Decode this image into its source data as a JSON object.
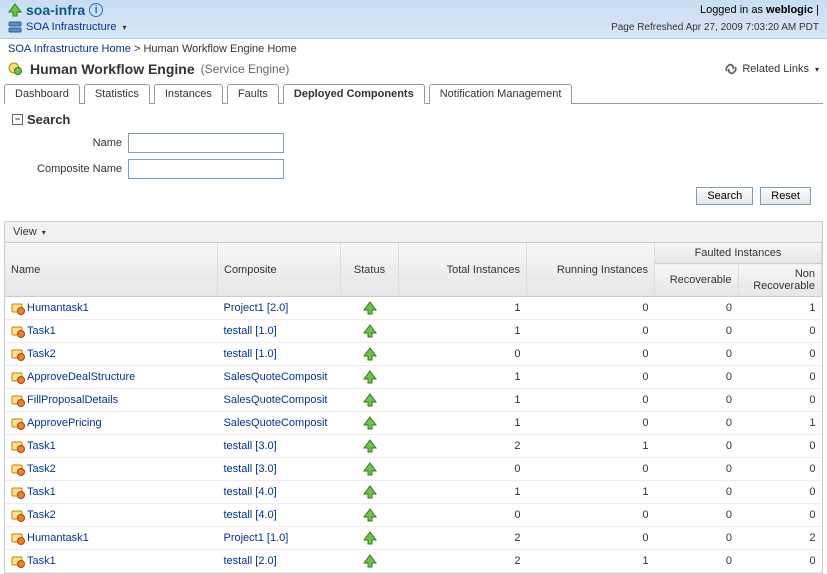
{
  "banner": {
    "title": "soa-infra",
    "infra_label": "SOA Infrastructure",
    "logged_in_prefix": "Logged in as ",
    "logged_in_user": "weblogic",
    "page_refreshed": "Page Refreshed Apr 27, 2009 7:03:20 AM PDT"
  },
  "breadcrumb": {
    "home": "SOA Infrastructure Home",
    "sep": " > ",
    "current": "Human Workflow Engine Home"
  },
  "page": {
    "title": "Human Workflow Engine",
    "subtitle": "(Service Engine)",
    "related_links": "Related Links"
  },
  "tabs": {
    "dashboard": "Dashboard",
    "statistics": "Statistics",
    "instances": "Instances",
    "faults": "Faults",
    "deployed": "Deployed Components",
    "notification": "Notification Management"
  },
  "search": {
    "title": "Search",
    "name_label": "Name",
    "composite_label": "Composite Name",
    "search_btn": "Search",
    "reset_btn": "Reset"
  },
  "view": {
    "label": "View"
  },
  "headers": {
    "name": "Name",
    "composite": "Composite",
    "status": "Status",
    "total": "Total Instances",
    "running": "Running Instances",
    "faulted": "Faulted Instances",
    "recoverable": "Recoverable",
    "non_recoverable": "Non Recoverable"
  },
  "rows": [
    {
      "name": "Humantask1",
      "composite": "Project1 [2.0]",
      "total": "1",
      "running": "0",
      "rec": "0",
      "nrec": "1"
    },
    {
      "name": "Task1",
      "composite": "testall [1.0]",
      "total": "1",
      "running": "0",
      "rec": "0",
      "nrec": "0"
    },
    {
      "name": "Task2",
      "composite": "testall [1.0]",
      "total": "0",
      "running": "0",
      "rec": "0",
      "nrec": "0"
    },
    {
      "name": "ApproveDealStructure",
      "composite": "SalesQuoteComposit",
      "total": "1",
      "running": "0",
      "rec": "0",
      "nrec": "0"
    },
    {
      "name": "FillProposalDetails",
      "composite": "SalesQuoteComposit",
      "total": "1",
      "running": "0",
      "rec": "0",
      "nrec": "0"
    },
    {
      "name": "ApprovePricing",
      "composite": "SalesQuoteComposit",
      "total": "1",
      "running": "0",
      "rec": "0",
      "nrec": "1"
    },
    {
      "name": "Task1",
      "composite": "testall [3.0]",
      "total": "2",
      "running": "1",
      "rec": "0",
      "nrec": "0"
    },
    {
      "name": "Task2",
      "composite": "testall [3.0]",
      "total": "0",
      "running": "0",
      "rec": "0",
      "nrec": "0"
    },
    {
      "name": "Task1",
      "composite": "testall [4.0]",
      "total": "1",
      "running": "1",
      "rec": "0",
      "nrec": "0"
    },
    {
      "name": "Task2",
      "composite": "testall [4.0]",
      "total": "0",
      "running": "0",
      "rec": "0",
      "nrec": "0"
    },
    {
      "name": "Humantask1",
      "composite": "Project1 [1.0]",
      "total": "2",
      "running": "0",
      "rec": "0",
      "nrec": "2"
    },
    {
      "name": "Task1",
      "composite": "testall [2.0]",
      "total": "2",
      "running": "1",
      "rec": "0",
      "nrec": "0"
    }
  ]
}
